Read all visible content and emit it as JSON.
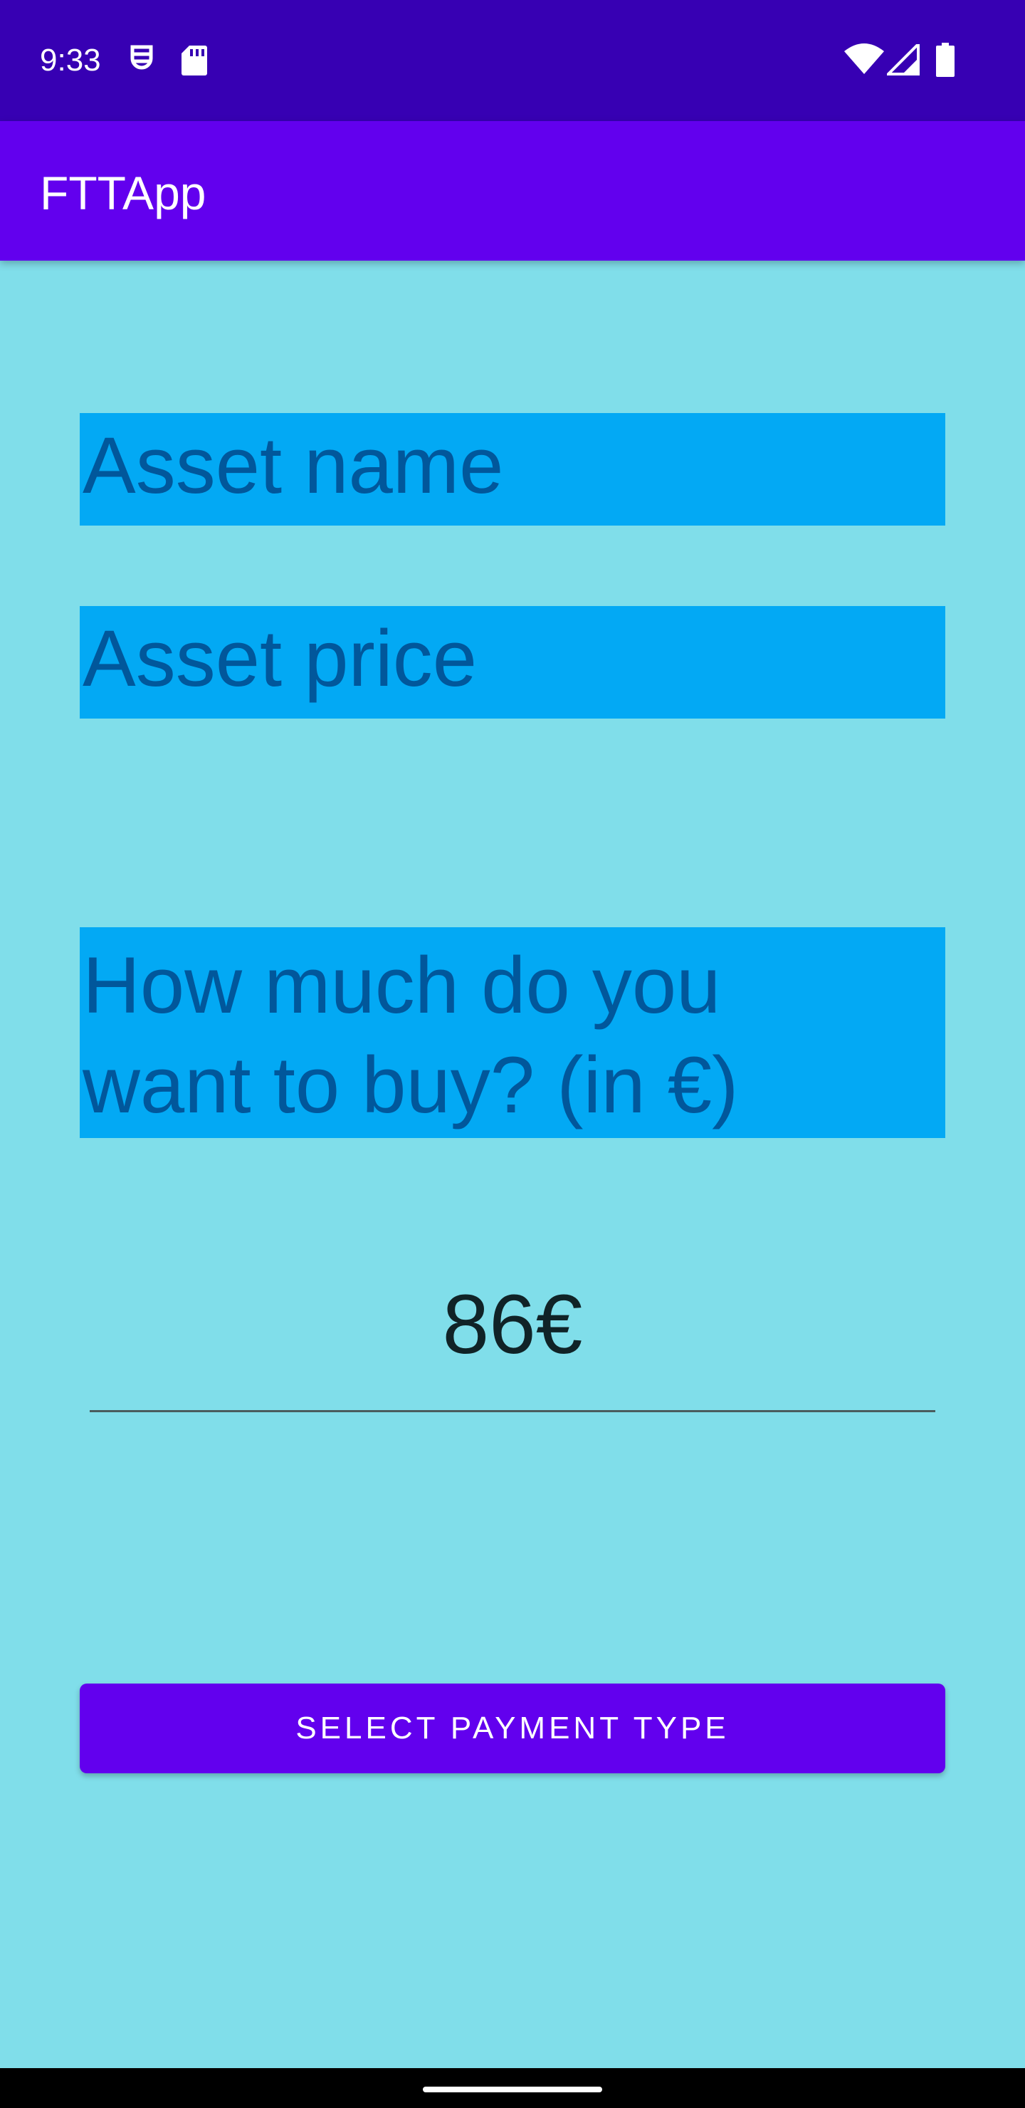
{
  "status_bar": {
    "time": "9:33",
    "left_icons": [
      "debug-icon",
      "sd-card-icon"
    ],
    "right_icons": [
      "wifi-icon",
      "cell-signal-icon",
      "battery-icon"
    ]
  },
  "app_bar": {
    "title": "FTTApp"
  },
  "form": {
    "asset_name_label": "Asset name",
    "asset_price_label": "Asset price",
    "amount_question": "How much do you want to buy? (in €)",
    "amount_value": "86€",
    "payment_button_label": "SELECT PAYMENT TYPE"
  },
  "colors": {
    "background": "#80DEEA",
    "status_bar": "#3700B3",
    "primary": "#6200EE",
    "field_bg": "#03A9F4",
    "field_text": "#01579B"
  }
}
